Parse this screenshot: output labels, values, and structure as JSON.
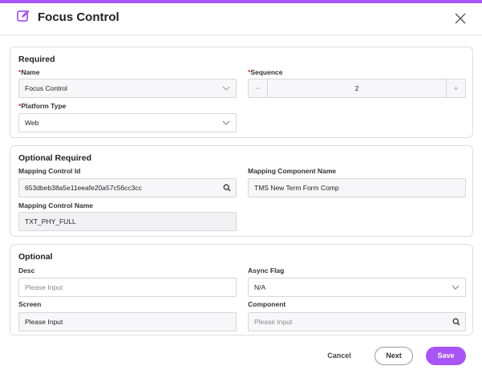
{
  "dialog": {
    "title": "Focus Control",
    "accent_color": "#a855f7",
    "title_icon": "edit-icon",
    "close_icon": "close-icon"
  },
  "required": {
    "title": "Required",
    "name_label": "Name",
    "name_value": "Focus Control",
    "sequence_label": "Sequence",
    "sequence_value": "2",
    "sequence_minus": "−",
    "sequence_plus": "+",
    "platform_label": "Platform Type",
    "platform_value": "Web",
    "required_marker": "*"
  },
  "optional_required": {
    "title": "Optional Required",
    "mapping_control_id_label": "Mapping Control Id",
    "mapping_control_id_value": "653dbeb38a5e11eeafe20a57c56cc3cc",
    "mapping_component_name_label": "Mapping Component Name",
    "mapping_component_name_value": "TMS New Term Form Comp",
    "mapping_control_name_label": "Mapping Control Name",
    "mapping_control_name_value": "TXT_PHY_FULL"
  },
  "optional": {
    "title": "Optional",
    "desc_label": "Desc",
    "desc_placeholder": "Please Input",
    "async_flag_label": "Async Flag",
    "async_flag_value": "N/A",
    "screen_label": "Screen",
    "screen_value": "Please Input",
    "component_label": "Component",
    "component_placeholder": "Please Input"
  },
  "footer": {
    "cancel_label": "Cancel",
    "next_label": "Next",
    "save_label": "Save"
  }
}
